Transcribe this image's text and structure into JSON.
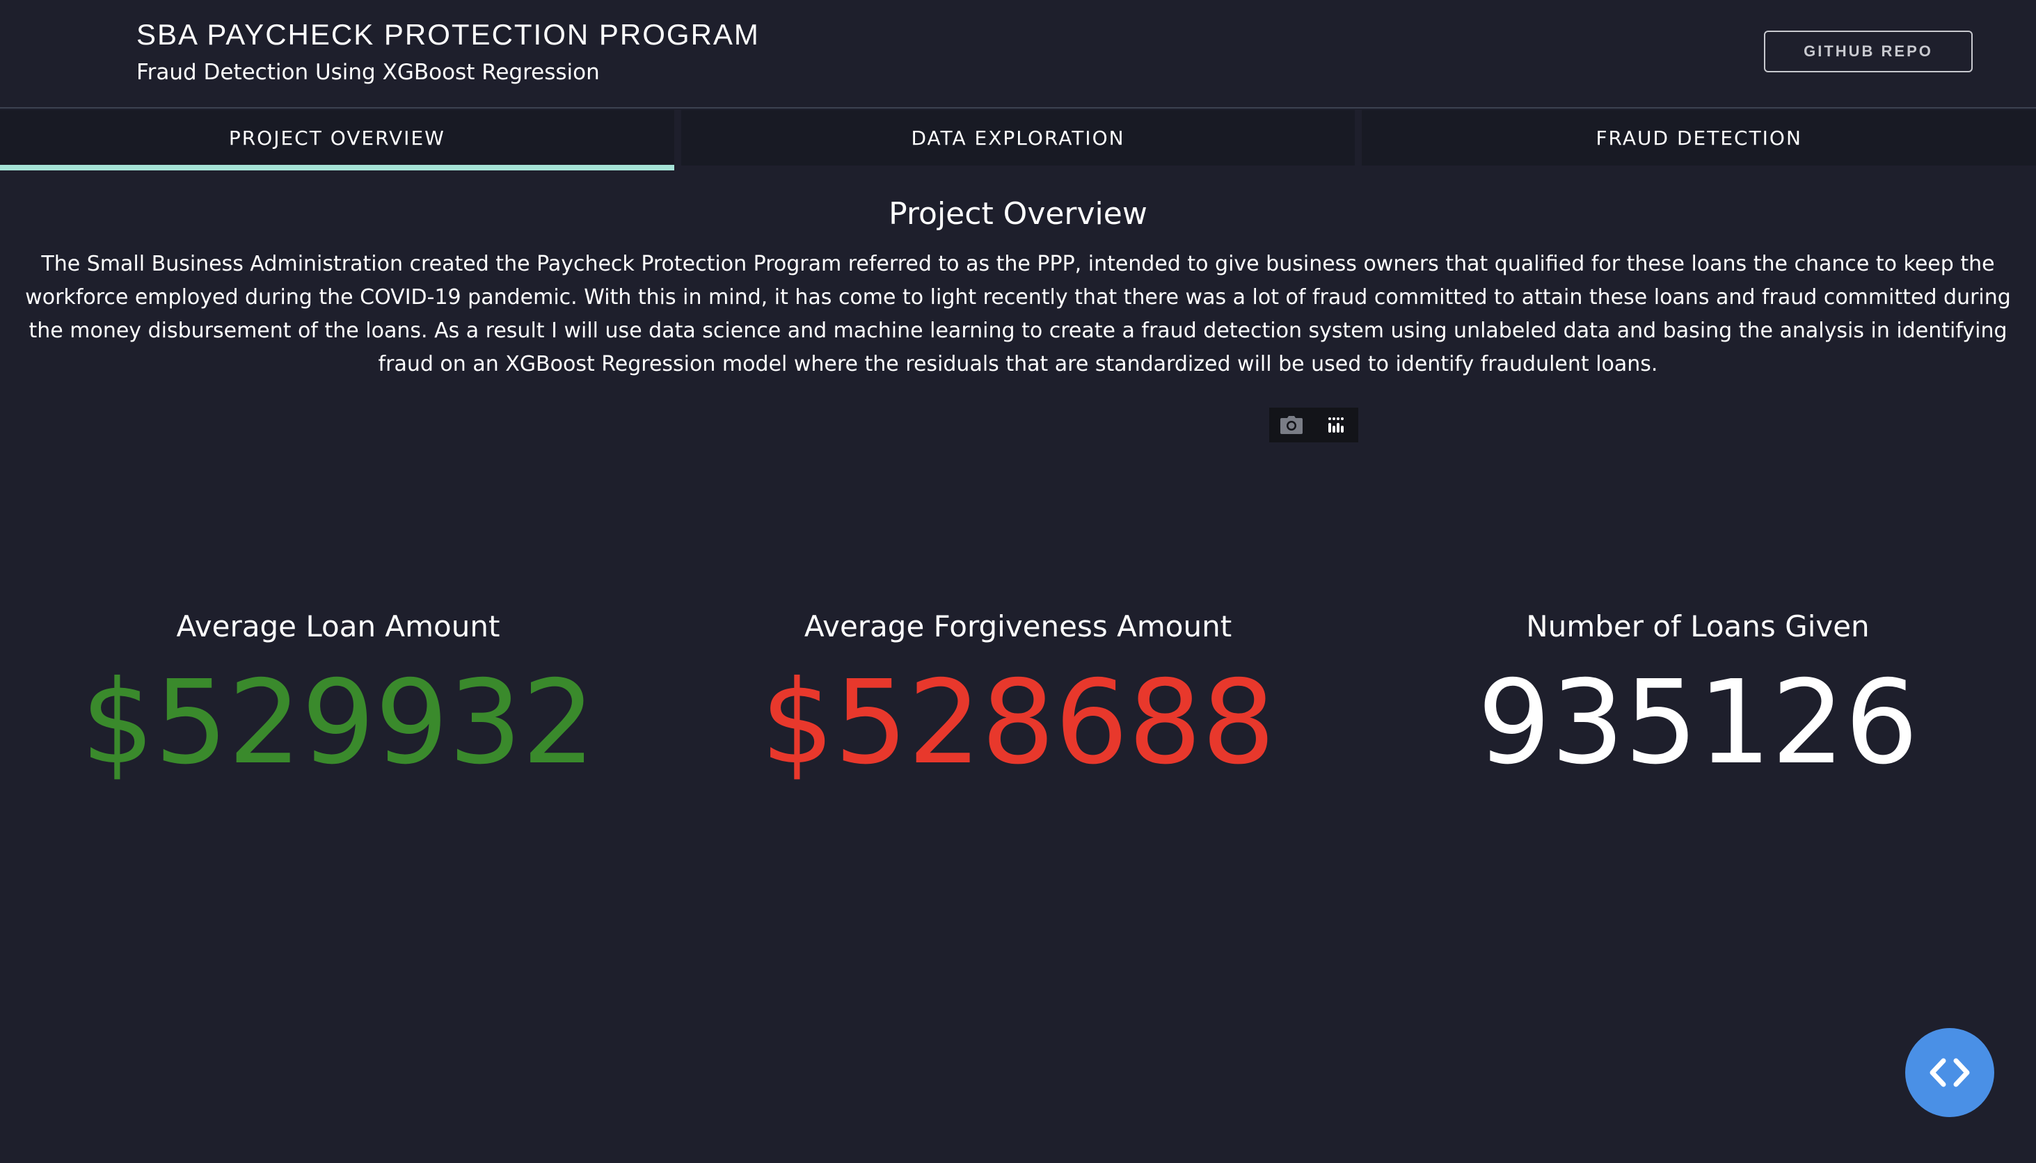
{
  "header": {
    "title": "SBA PAYCHECK PROTECTION PROGRAM",
    "subtitle": "Fraud Detection Using XGBoost Regression",
    "repo_button": "GITHUB REPO"
  },
  "tabs": [
    {
      "label": "PROJECT OVERVIEW",
      "active": true
    },
    {
      "label": "DATA EXPLORATION",
      "active": false
    },
    {
      "label": "FRAUD DETECTION",
      "active": false
    }
  ],
  "overview": {
    "title": "Project Overview",
    "text": "The Small Business Administration created the Paycheck Protection Program referred to as the PPP, intended to give business owners that qualified for these loans the chance to keep the workforce employed during the COVID-19 pandemic. With this in mind, it has come to light recently that there was a lot of fraud committed to attain these loans and fraud committed during the money disbursement of the loans. As a result I will use data science and machine learning to create a fraud detection system using unlabeled data and basing the analysis in identifying fraud on an XGBoost Regression model where the residuals that are standardized will be used to identify fraudulent loans."
  },
  "modebar": {
    "icons": [
      "camera-icon",
      "plotly-logo-icon"
    ]
  },
  "kpis": [
    {
      "label": "Average Loan Amount",
      "value": "$529932",
      "color": "#3a8a2c"
    },
    {
      "label": "Average Forgiveness Amount",
      "value": "$528688",
      "color": "#e8382c"
    },
    {
      "label": "Number of Loans Given",
      "value": "935126",
      "color": "#ffffff"
    }
  ],
  "colors": {
    "background": "#1e1f2c",
    "tab_background": "#181a24",
    "tab_active_indicator": "#a6e3d7",
    "fab": "#4a90e6"
  },
  "fab": {
    "icon": "code-brackets-icon"
  }
}
